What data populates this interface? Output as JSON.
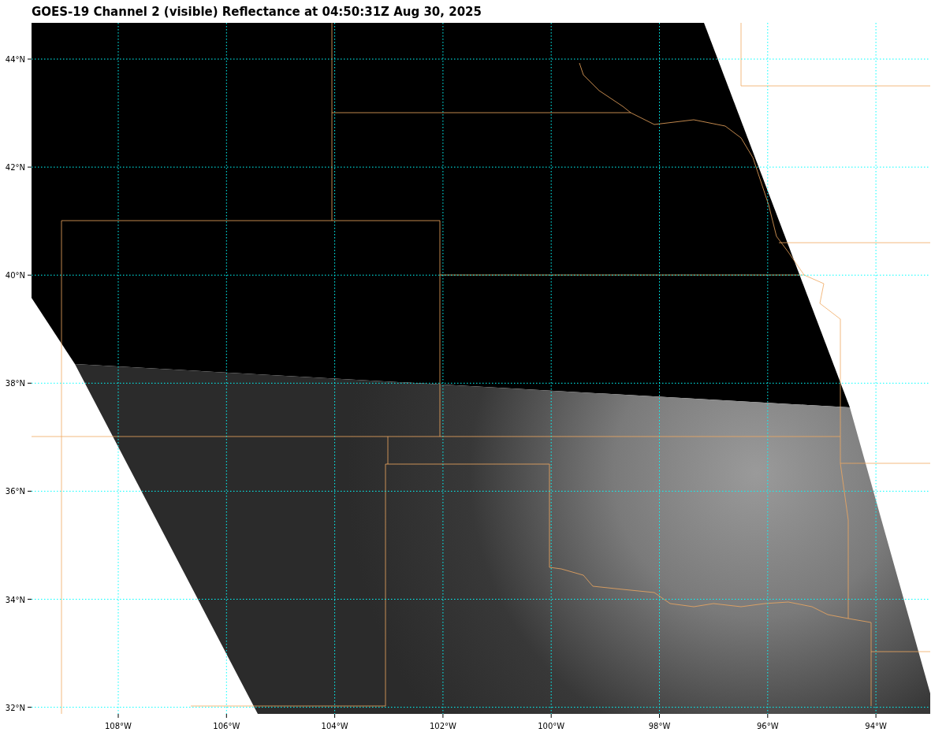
{
  "title": "GOES-19 Channel 2 (visible) Reflectance at 04:50:31Z Aug 30, 2025",
  "map": {
    "lat_labels": [
      "44°N",
      "42°N",
      "40°N",
      "38°N",
      "36°N",
      "34°N",
      "32°N"
    ],
    "lon_labels": [
      "108°W",
      "106°W",
      "104°W",
      "102°W",
      "100°W",
      "98°W",
      "96°W",
      "94°W"
    ]
  }
}
